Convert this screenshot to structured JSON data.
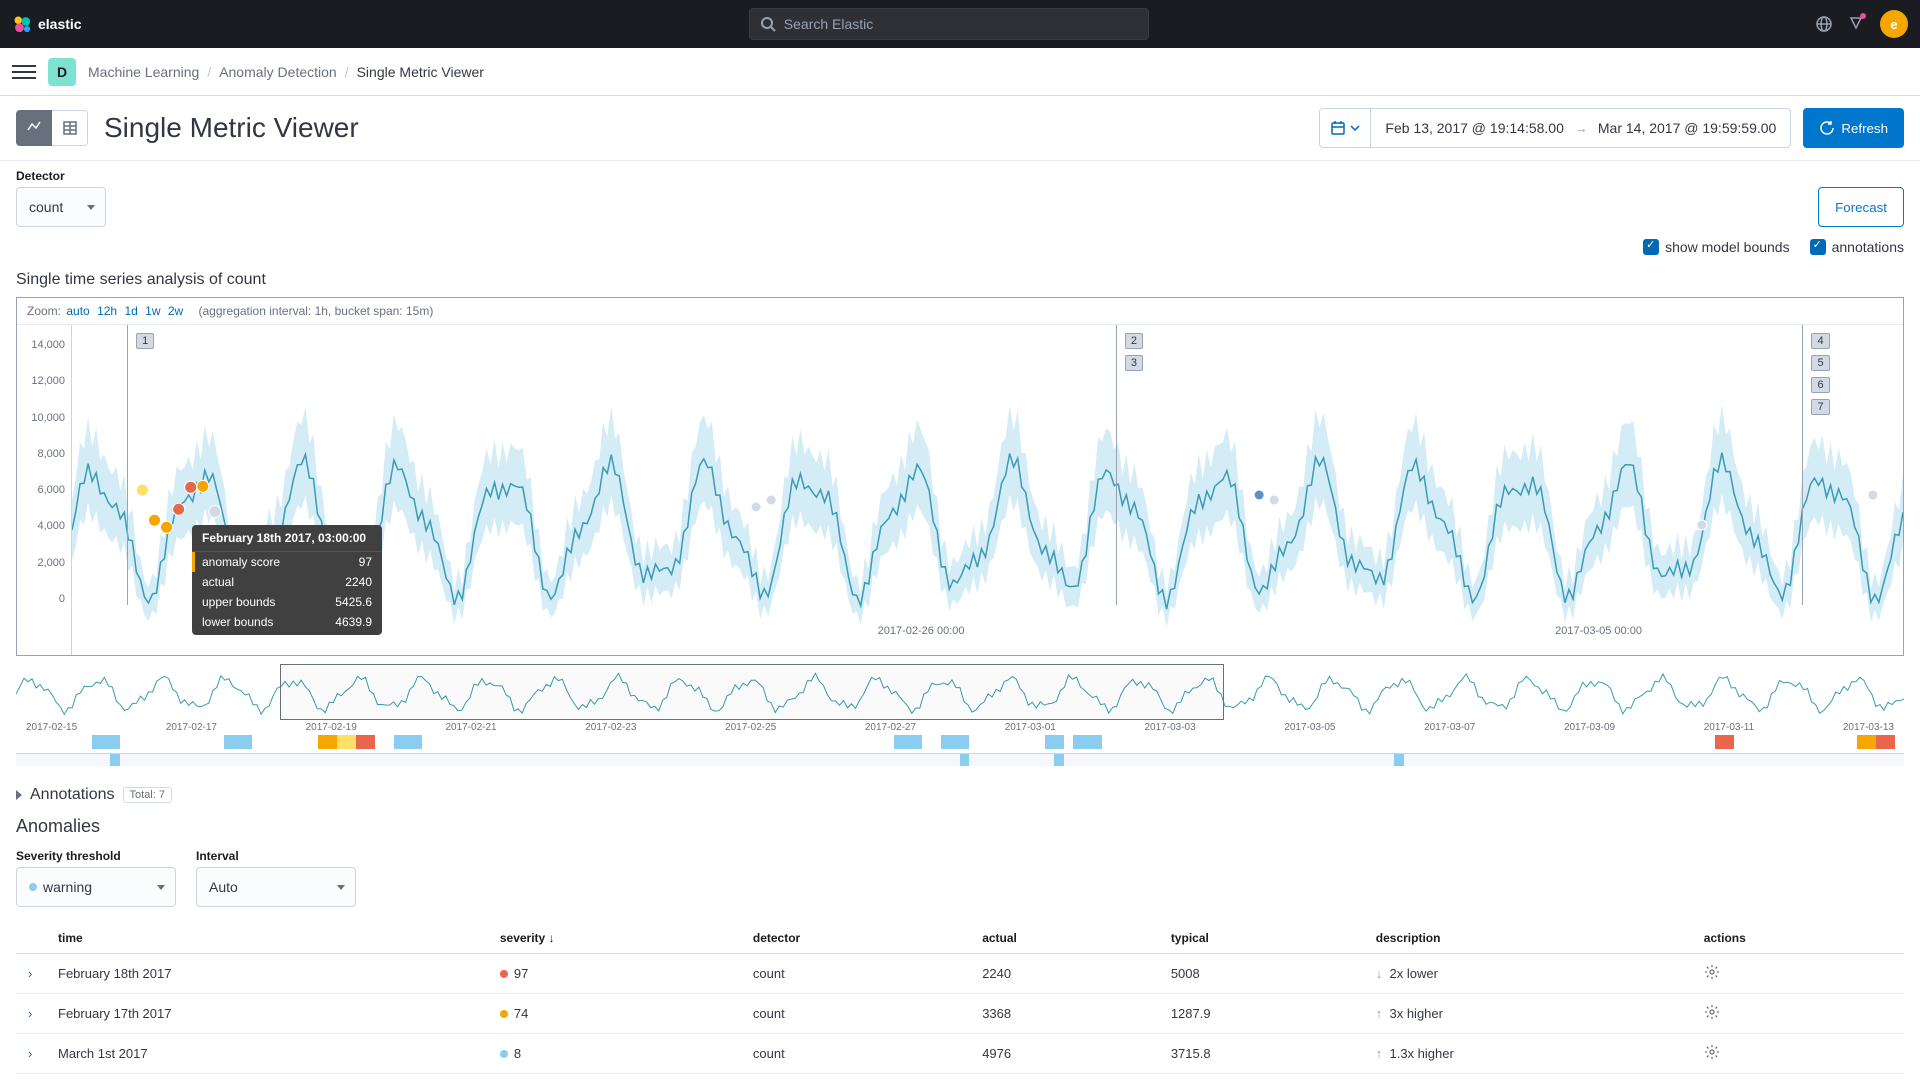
{
  "brand": "elastic",
  "search": {
    "placeholder": "Search Elastic"
  },
  "avatar_letter": "e",
  "space_letter": "D",
  "breadcrumbs": [
    "Machine Learning",
    "Anomaly Detection",
    "Single Metric Viewer"
  ],
  "page_title": "Single Metric Viewer",
  "date_range": {
    "from": "Feb 13, 2017 @ 19:14:58.00",
    "to": "Mar 14, 2017 @ 19:59:59.00"
  },
  "refresh_label": "Refresh",
  "forecast_label": "Forecast",
  "detector_label": "Detector",
  "detector_value": "count",
  "checkbox_bounds": "show model bounds",
  "checkbox_annotations": "annotations",
  "chart_section_title": "Single time series analysis of count",
  "zoom": {
    "label": "Zoom:",
    "levels": [
      "auto",
      "12h",
      "1d",
      "1w",
      "2w"
    ],
    "info": "(aggregation interval: 1h, bucket span: 15m)"
  },
  "markers": {
    "left": [
      "1"
    ],
    "mid": [
      "2",
      "3"
    ],
    "right": [
      "4",
      "5",
      "6",
      "7"
    ]
  },
  "tooltip": {
    "header": "February 18th 2017, 03:00:00",
    "rows": [
      {
        "label": "anomaly score",
        "value": "97",
        "highlight": true
      },
      {
        "label": "actual",
        "value": "2240"
      },
      {
        "label": "upper bounds",
        "value": "5425.6"
      },
      {
        "label": "lower bounds",
        "value": "4639.9"
      }
    ]
  },
  "chart_data": {
    "type": "line",
    "title": "Single time series analysis of count",
    "ylabel": "",
    "ylim": [
      0,
      14000
    ],
    "y_ticks": [
      "14,000",
      "12,000",
      "10,000",
      "8,000",
      "6,000",
      "4,000",
      "2,000",
      "0"
    ],
    "x_ticks_main": [
      "2017-02-26 00:00",
      "2017-03-05 00:00"
    ],
    "x_ticks_overview": [
      "2017-02-15",
      "2017-02-17",
      "2017-02-19",
      "2017-02-21",
      "2017-02-23",
      "2017-02-25",
      "2017-02-27",
      "2017-03-01",
      "2017-03-03",
      "2017-03-05",
      "2017-03-07",
      "2017-03-09",
      "2017-03-11",
      "2017-03-13"
    ],
    "series": [
      {
        "name": "count",
        "pattern": "daily-oscillation",
        "mean": 4000,
        "peak": 6000,
        "trough": 1000
      }
    ],
    "anomaly_points": [
      {
        "date": "2017-02-18",
        "score": 97,
        "actual": 2240,
        "typical": 5008,
        "color": "#e7664c"
      },
      {
        "date": "2017-02-17",
        "score": 74,
        "actual": 3368,
        "typical": 1287.9,
        "color": "#f5a700"
      },
      {
        "date": "2017-03-01",
        "score": 8,
        "actual": 4976,
        "typical": 3715.8,
        "color": "#8bcdf0"
      }
    ]
  },
  "annotations_title": "Annotations",
  "annotations_total": "Total: 7",
  "anomalies_title": "Anomalies",
  "severity_label": "Severity threshold",
  "severity_value": "warning",
  "interval_label": "Interval",
  "interval_value": "Auto",
  "table": {
    "columns": [
      "time",
      "severity",
      "detector",
      "actual",
      "typical",
      "description",
      "actions"
    ],
    "sort_indicator": "↓",
    "rows": [
      {
        "time": "February 18th 2017",
        "severity": "97",
        "sev_color": "#e7664c",
        "detector": "count",
        "actual": "2240",
        "typical": "5008",
        "desc_arrow": "↓",
        "desc": "2x lower"
      },
      {
        "time": "February 17th 2017",
        "severity": "74",
        "sev_color": "#f5a700",
        "detector": "count",
        "actual": "3368",
        "typical": "1287.9",
        "desc_arrow": "↑",
        "desc": "3x higher"
      },
      {
        "time": "March 1st 2017",
        "severity": "8",
        "sev_color": "#8bcdf0",
        "detector": "count",
        "actual": "4976",
        "typical": "3715.8",
        "desc_arrow": "↑",
        "desc": "1.3x higher"
      }
    ]
  },
  "colors": {
    "primary": "#07c",
    "link": "#006bb4"
  }
}
